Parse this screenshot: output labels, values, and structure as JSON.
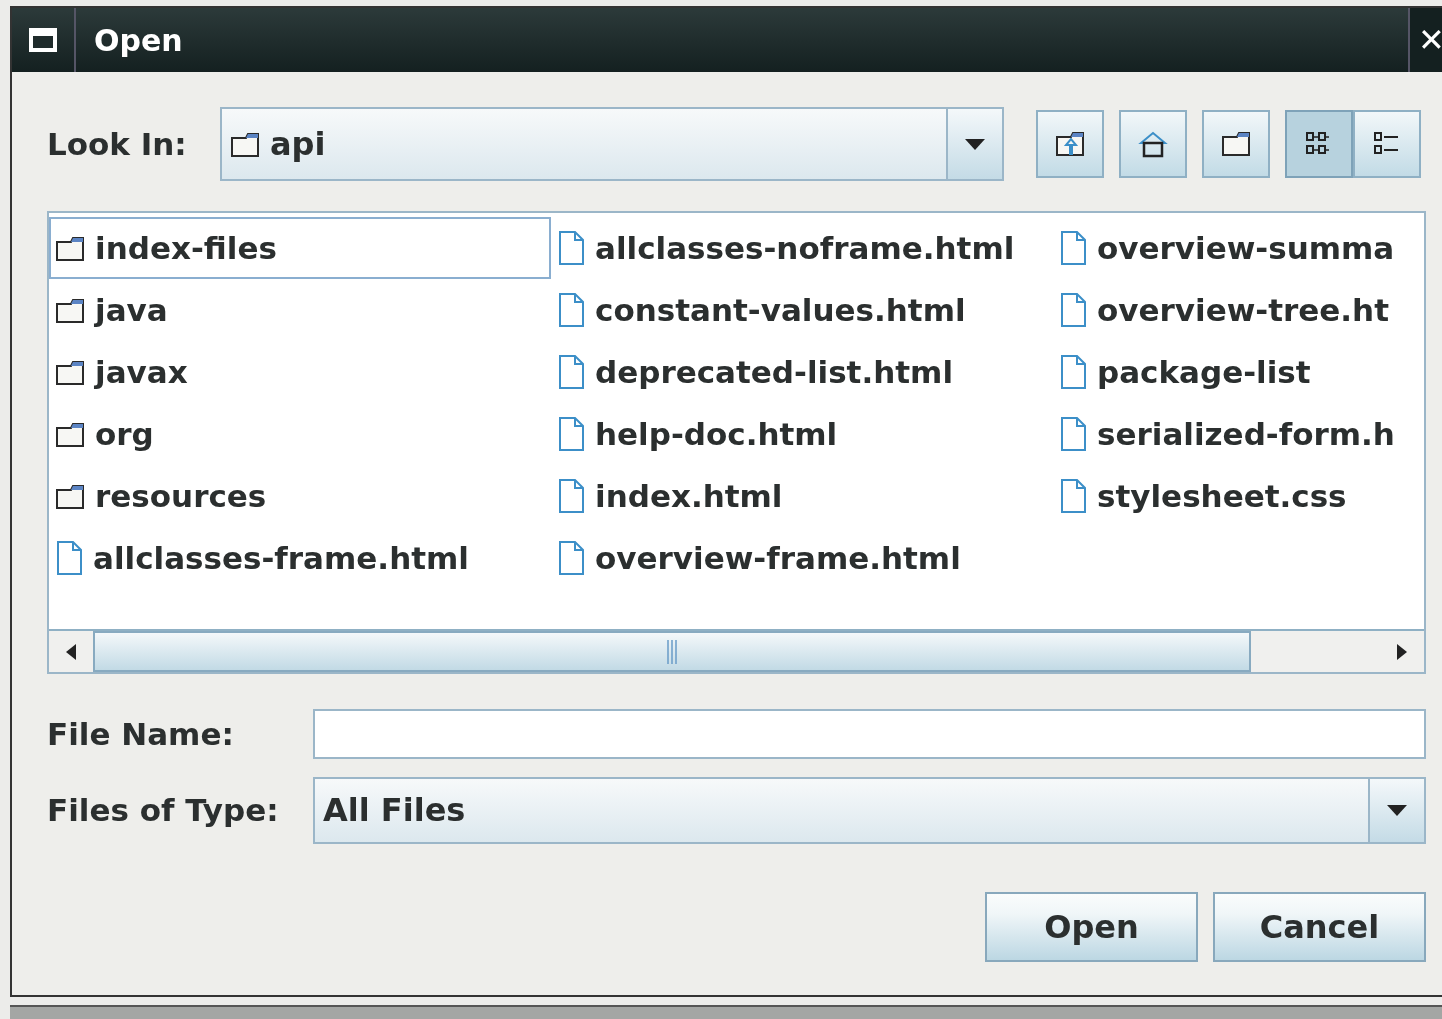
{
  "window": {
    "title": "Open",
    "close": "✕"
  },
  "look_in": {
    "label": "Look In:",
    "value": "api"
  },
  "toolbar": [
    {
      "kind": "up",
      "selected": false
    },
    {
      "kind": "home",
      "selected": false
    },
    {
      "kind": "newfolder",
      "selected": false
    },
    {
      "kind": "list",
      "selected": true
    },
    {
      "kind": "details",
      "selected": false
    }
  ],
  "files": [
    {
      "name": "index-files",
      "kind": "folder",
      "selected": true
    },
    {
      "name": "java",
      "kind": "folder",
      "selected": false
    },
    {
      "name": "javax",
      "kind": "folder",
      "selected": false
    },
    {
      "name": "org",
      "kind": "folder",
      "selected": false
    },
    {
      "name": "resources",
      "kind": "folder",
      "selected": false
    },
    {
      "name": "allclasses-frame.html",
      "kind": "file",
      "selected": false
    },
    {
      "name": "allclasses-noframe.html",
      "kind": "file",
      "selected": false
    },
    {
      "name": "constant-values.html",
      "kind": "file",
      "selected": false
    },
    {
      "name": "deprecated-list.html",
      "kind": "file",
      "selected": false
    },
    {
      "name": "help-doc.html",
      "kind": "file",
      "selected": false
    },
    {
      "name": "index.html",
      "kind": "file",
      "selected": false
    },
    {
      "name": "overview-frame.html",
      "kind": "file",
      "selected": false
    },
    {
      "name": "overview-summa",
      "kind": "file",
      "selected": false
    },
    {
      "name": "overview-tree.ht",
      "kind": "file",
      "selected": false
    },
    {
      "name": "package-list",
      "kind": "file",
      "selected": false
    },
    {
      "name": "serialized-form.h",
      "kind": "file",
      "selected": false
    },
    {
      "name": "stylesheet.css",
      "kind": "file",
      "selected": false
    }
  ],
  "file_name": {
    "label": "File Name:"
  },
  "file_type": {
    "label": "Files of Type:",
    "value": "All Files"
  },
  "buttons": [
    "Open",
    "Cancel"
  ]
}
